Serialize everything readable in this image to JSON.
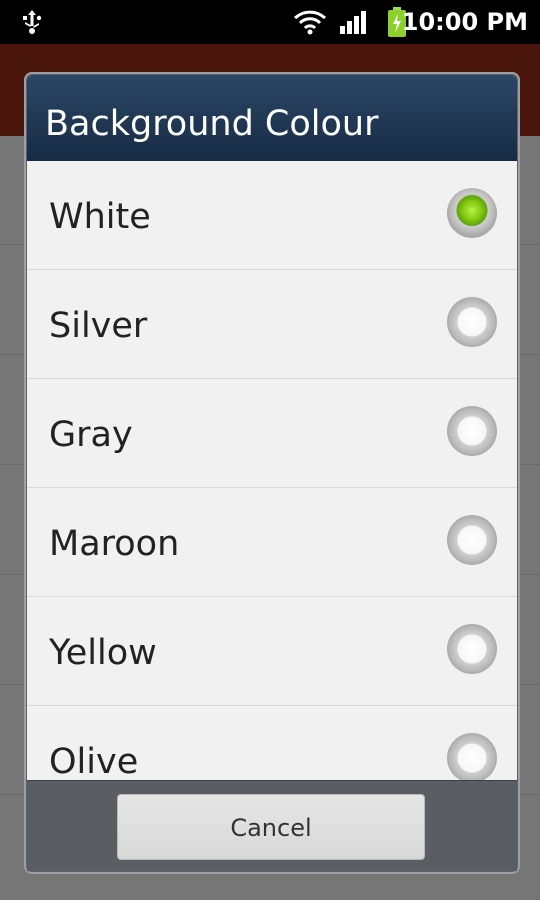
{
  "status_bar": {
    "time": "10:00 PM",
    "icons": [
      "usb-icon",
      "wifi-icon",
      "signal-icon",
      "battery-charging-icon"
    ]
  },
  "dialog": {
    "title": "Background Colour",
    "options": [
      {
        "label": "White",
        "checked": true
      },
      {
        "label": "Silver",
        "checked": false
      },
      {
        "label": "Gray",
        "checked": false
      },
      {
        "label": "Maroon",
        "checked": false
      },
      {
        "label": "Yellow",
        "checked": false
      },
      {
        "label": "Olive",
        "checked": false
      }
    ],
    "cancel_label": "Cancel"
  },
  "colors": {
    "dialog_header": "#1f3650",
    "radio_checked": "#7ec011",
    "app_bar": "#4a160b",
    "status_bar": "#000000"
  }
}
